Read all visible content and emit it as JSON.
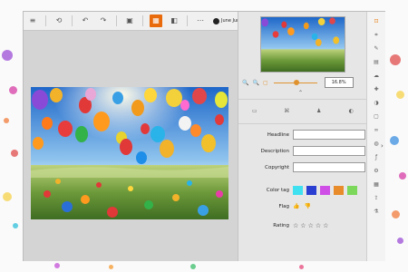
{
  "toolbar": {
    "menu_icon": "menu-icon",
    "back_icon": "back-icon",
    "undo_icon": "undo-icon",
    "redo_icon": "redo-icon",
    "save_icon": "save-icon",
    "grid_view_icon": "grid-view-icon",
    "split_view_icon": "split-view-icon",
    "more_icon": "more-icon",
    "user_name": "June June"
  },
  "zoom": {
    "value": "16.8%"
  },
  "metadata": {
    "headline_label": "Headline",
    "description_label": "Description",
    "copyright_label": "Copyright",
    "color_tag_label": "Color tag",
    "flag_label": "Flag",
    "rating_label": "Rating",
    "color_tags": [
      "#3fe0f0",
      "#2a3fd1",
      "#cf4fe6",
      "#e88b2a",
      "#7cd85a"
    ],
    "rating_stars": 5
  },
  "accent": "#e86a0b"
}
